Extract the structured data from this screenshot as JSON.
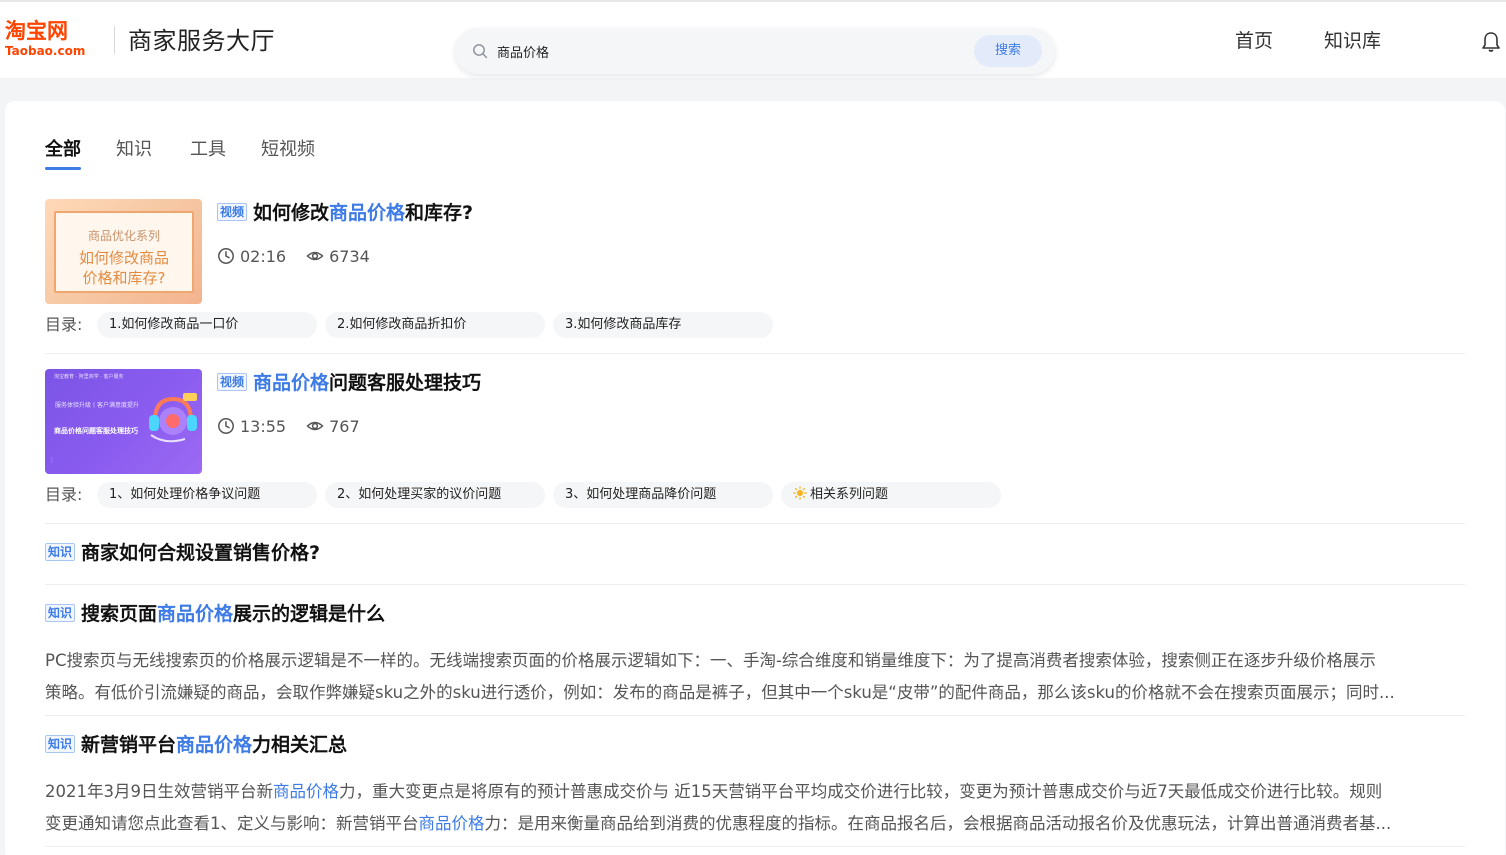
{
  "header": {
    "logo_cn": "淘宝网",
    "logo_en": "Taobao.com",
    "site_title": "商家服务大厅",
    "search": {
      "value": "商品价格",
      "button": "搜索"
    },
    "nav": [
      "首页",
      "知识库"
    ]
  },
  "tabs": [
    "全部",
    "知识",
    "工具",
    "短视频"
  ],
  "results": {
    "video1": {
      "badge": "视频",
      "title_pre": "如何修改",
      "title_hl": "商品价格",
      "title_post": "和库存?",
      "thumb_line1": "商品优化系列",
      "thumb_line2": "如何修改商品",
      "thumb_line3": "价格和库存?",
      "duration": "02:16",
      "views": "6734",
      "toc_label": "目录:",
      "toc": [
        "1.如何修改商品一口价",
        "2.如何修改商品折扣价",
        "3.如何修改商品库存"
      ]
    },
    "video2": {
      "badge": "视频",
      "title_hl": "商品价格",
      "title_post": "问题客服处理技巧",
      "thumb_small": "淘宝教育 · 阿里商学 · 客户服务",
      "thumb_mid": "服务体验升级丨客户满意度提升",
      "thumb_main": "商品价格问题客服处理技巧",
      "thumb_dots": "⋮",
      "duration": "13:55",
      "views": "767",
      "toc_label": "目录:",
      "toc": [
        "1、如何处理价格争议问题",
        "2、如何处理买家的议价问题",
        "3、如何处理商品降价问题",
        "相关系列问题"
      ]
    },
    "kb1": {
      "badge": "知识",
      "title": "商家如何合规设置销售价格?"
    },
    "kb2": {
      "badge": "知识",
      "title_pre": "搜索页面",
      "title_hl": "商品价格",
      "title_post": "展示的逻辑是什么",
      "line1": "PC搜索页与无线搜索页的价格展示逻辑是不一样的。无线端搜索页面的价格展示逻辑如下：一、手淘-综合维度和销量维度下：为了提高消费者搜索体验，搜索侧正在逐步升级价格展示",
      "line2": "策略。有低价引流嫌疑的商品，会取作弊嫌疑sku之外的sku进行透价，例如：发布的商品是裤子，但其中一个sku是“皮带”的配件商品，那么该sku的价格就不会在搜索页面展示；同时..."
    },
    "kb3": {
      "badge": "知识",
      "title_pre": "新营销平台",
      "title_hl": "商品价格",
      "title_post": "力相关汇总",
      "line1_pre": "2021年3月9日生效营销平台新",
      "line1_hl": "商品价格",
      "line1_post": "力，重大变更点是将原有的预计普惠成交价与 近15天营销平台平均成交价进行比较，变更为预计普惠成交价与近7天最低成交价进行比较。规则",
      "line2_pre": "变更通知请您点此查看1、定义与影响：新营销平台",
      "line2_hl": "商品价格",
      "line2_post": "力：是用来衡量商品给到消费的优惠程度的指标。在商品报名后，会根据商品活动报名价及优惠玩法，计算出普通消费者基..."
    }
  },
  "colors": {
    "accent": "#3d7be6",
    "brand": "#ff4400"
  }
}
